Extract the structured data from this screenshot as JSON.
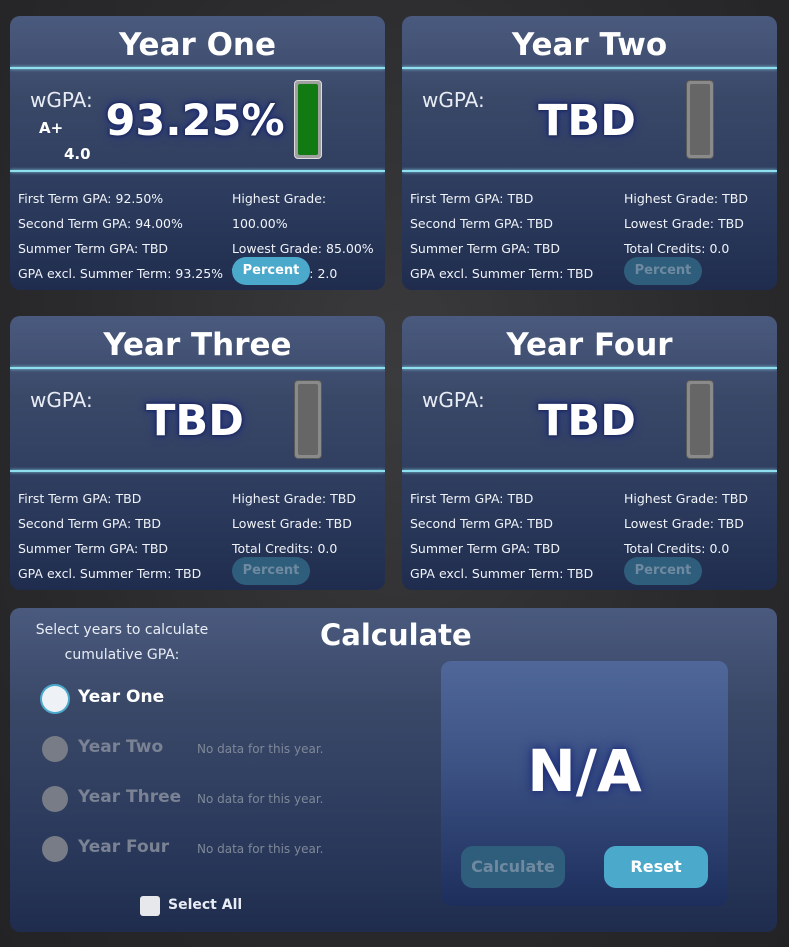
{
  "years": [
    {
      "title": "Year One",
      "wgpa_label": "wGPA:",
      "value": "93.25%",
      "letter": "A+",
      "points": "4.0",
      "bar_state": "filled",
      "first_term": "First Term GPA: 92.50%",
      "second_term": "Second Term GPA: 94.00%",
      "summer_term": "Summer Term GPA: TBD",
      "excl_summer": "GPA excl. Summer Term: 93.25%",
      "highest": "Highest Grade: 100.00%",
      "lowest": "Lowest Grade: 85.00%",
      "credits": "Total Credits: 2.0",
      "percent_button": "Percent",
      "percent_enabled": true
    },
    {
      "title": "Year Two",
      "wgpa_label": "wGPA:",
      "value": "TBD",
      "letter": "",
      "points": "",
      "bar_state": "empty",
      "first_term": "First Term GPA: TBD",
      "second_term": "Second Term GPA: TBD",
      "summer_term": "Summer Term GPA: TBD",
      "excl_summer": "GPA excl. Summer Term: TBD",
      "highest": "Highest Grade: TBD",
      "lowest": "Lowest Grade: TBD",
      "credits": "Total Credits: 0.0",
      "percent_button": "Percent",
      "percent_enabled": false
    },
    {
      "title": "Year Three",
      "wgpa_label": "wGPA:",
      "value": "TBD",
      "letter": "",
      "points": "",
      "bar_state": "empty",
      "first_term": "First Term GPA: TBD",
      "second_term": "Second Term GPA: TBD",
      "summer_term": "Summer Term GPA: TBD",
      "excl_summer": "GPA excl. Summer Term: TBD",
      "highest": "Highest Grade: TBD",
      "lowest": "Lowest Grade: TBD",
      "credits": "Total Credits: 0.0",
      "percent_button": "Percent",
      "percent_enabled": false
    },
    {
      "title": "Year Four",
      "wgpa_label": "wGPA:",
      "value": "TBD",
      "letter": "",
      "points": "",
      "bar_state": "empty",
      "first_term": "First Term GPA: TBD",
      "second_term": "Second Term GPA: TBD",
      "summer_term": "Summer Term GPA: TBD",
      "excl_summer": "GPA excl. Summer Term: TBD",
      "highest": "Highest Grade: TBD",
      "lowest": "Lowest Grade: TBD",
      "credits": "Total Credits: 0.0",
      "percent_button": "Percent",
      "percent_enabled": false
    }
  ],
  "calculate": {
    "title": "Calculate",
    "instructions_line1": "Select years to calculate",
    "instructions_line2": "cumulative GPA:",
    "options": [
      {
        "label": "Year One",
        "note": "",
        "enabled": true,
        "selected": false
      },
      {
        "label": "Year Two",
        "note": "No data for this year.",
        "enabled": false,
        "selected": false
      },
      {
        "label": "Year Three",
        "note": "No data for this year.",
        "enabled": false,
        "selected": false
      },
      {
        "label": "Year Four",
        "note": "No data for this year.",
        "enabled": false,
        "selected": false
      }
    ],
    "select_all_label": "Select All",
    "result": "N/A",
    "calculate_button": "Calculate",
    "reset_button": "Reset"
  },
  "colors": {
    "accent": "#4ba9cc",
    "separator": "#8ee0f0",
    "bar_fill": "#127a12"
  }
}
